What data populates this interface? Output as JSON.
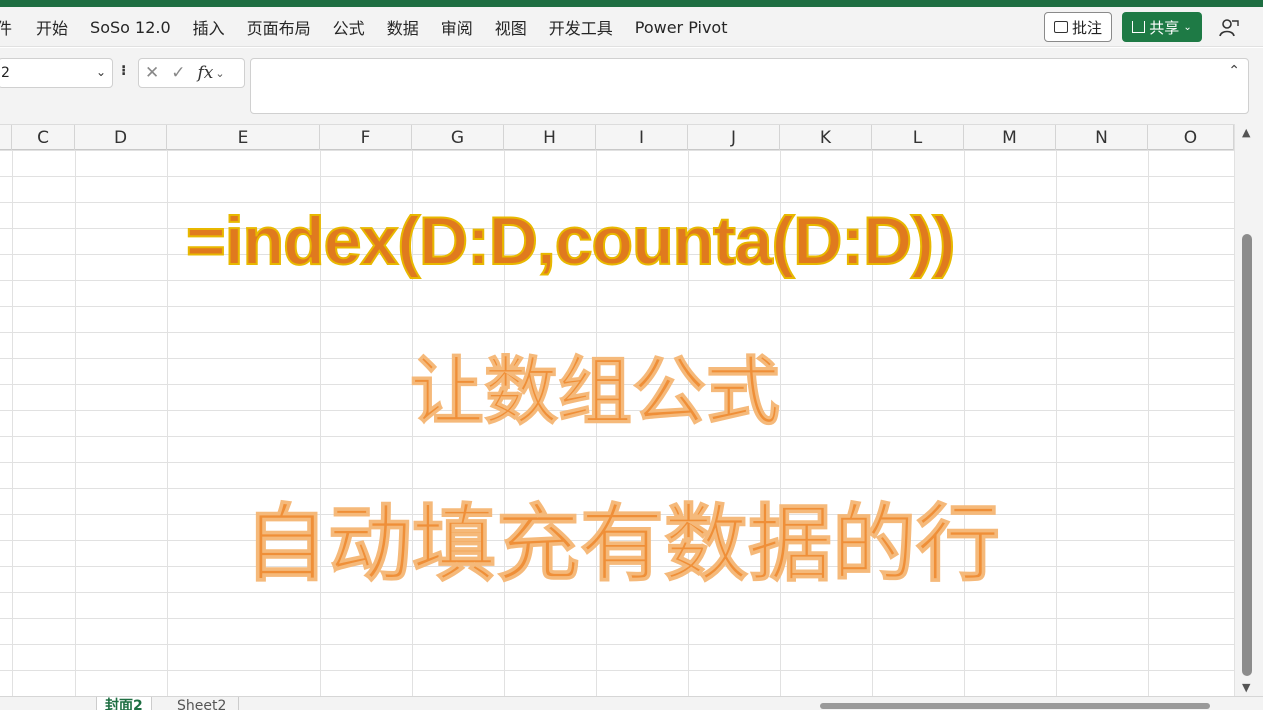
{
  "app": {
    "accent_color": "#1e6e42"
  },
  "ribbon": {
    "tabs": [
      "件",
      "开始",
      "SoSo 12.0",
      "插入",
      "页面布局",
      "公式",
      "数据",
      "审阅",
      "视图",
      "开发工具",
      "Power Pivot"
    ],
    "comment_label": "批注",
    "share_label": "共享",
    "comment_icon": "comment-icon",
    "share_icon": "share-icon",
    "coauthor_icon": "coauthor-icon"
  },
  "formula_bar": {
    "name_box_value": "2",
    "cancel_glyph": "✕",
    "enter_glyph": "✓",
    "fx_label": "fx",
    "formula_value": ""
  },
  "columns": [
    "C",
    "D",
    "E",
    "F",
    "G",
    "H",
    "I",
    "J",
    "K",
    "L",
    "M",
    "N",
    "O"
  ],
  "overlay": {
    "formula_text": "=index(D:D,counta(D:D))",
    "line1": "让数组公式",
    "line2": "自动填充有数据的行",
    "formula_color": "#e07a1e",
    "text_color": "#ef8f38"
  },
  "sheet_tabs": [
    {
      "label": "封面2",
      "active": true
    },
    {
      "label": "Sheet2",
      "active": false
    }
  ]
}
